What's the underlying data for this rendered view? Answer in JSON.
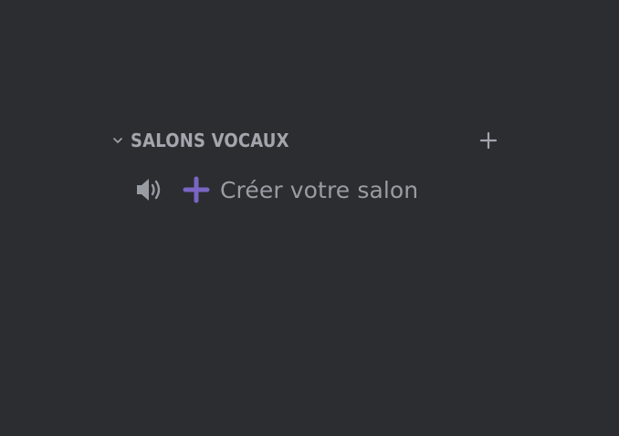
{
  "category": {
    "label": "SALONS VOCAUX",
    "chevron_icon": "chevron-down-icon",
    "add_icon": "plus-icon"
  },
  "channel": {
    "label": "Créer votre salon",
    "type_icon": "speaker-icon",
    "prefix_icon": "plus-icon"
  },
  "colors": {
    "background": "#2b2d31",
    "category_text": "#a3a6ad",
    "channel_text": "#9a9ca3",
    "accent_purple": "#7a65c2"
  }
}
